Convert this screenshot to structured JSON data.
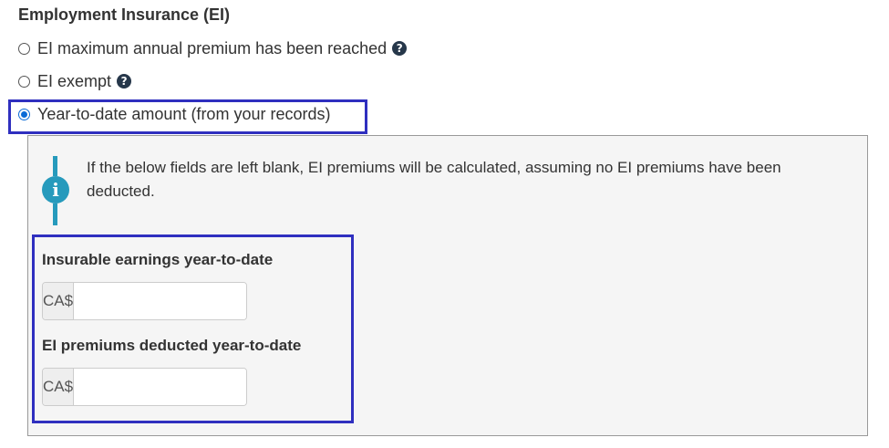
{
  "section": {
    "title": "Employment Insurance (EI)"
  },
  "options": [
    {
      "label": "EI maximum annual premium has been reached",
      "help": "?"
    },
    {
      "label": "EI exempt",
      "help": "?"
    },
    {
      "label": "Year-to-date amount (from your records)"
    }
  ],
  "info": {
    "icon": "info-icon",
    "text": "If the below fields are left blank, EI premiums will be calculated, assuming no EI premiums have been deducted."
  },
  "fields": {
    "insurable": {
      "label": "Insurable earnings year-to-date",
      "prefix": "CA$",
      "value": ""
    },
    "premiums": {
      "label": "EI premiums deducted year-to-date",
      "prefix": "CA$",
      "value": ""
    }
  },
  "colors": {
    "highlight": "#2f2fbf",
    "info": "#269abc",
    "radio_checked": "#0b6bd6"
  }
}
